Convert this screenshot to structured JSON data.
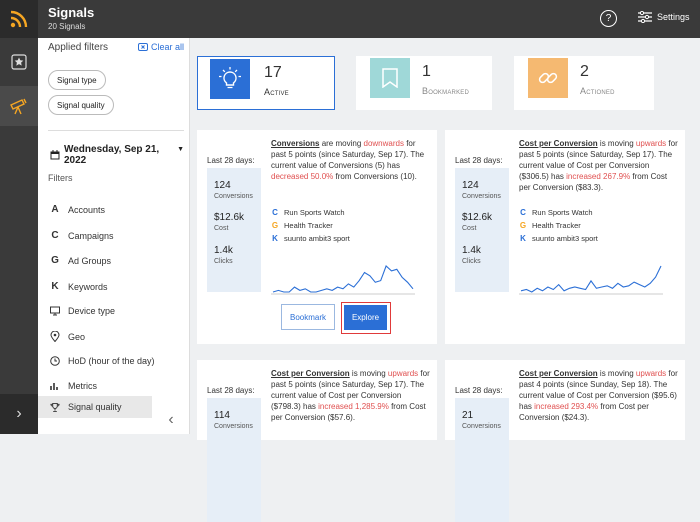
{
  "header": {
    "title": "Signals",
    "subtitle": "20 Signals",
    "settings_label": "Settings",
    "help_glyph": "?"
  },
  "sidebar": {
    "applied_label": "Applied filters",
    "clear_label": "Clear all",
    "pills": [
      "Signal type",
      "Signal quality"
    ],
    "date": "Wednesday, Sep 21, 2022",
    "filters_label": "Filters",
    "items": [
      {
        "icon": "A",
        "label": "Accounts"
      },
      {
        "icon": "C",
        "label": "Campaigns"
      },
      {
        "icon": "G",
        "label": "Ad Groups"
      },
      {
        "icon": "K",
        "label": "Keywords"
      },
      {
        "icon": "device",
        "label": "Device type"
      },
      {
        "icon": "geo",
        "label": "Geo"
      },
      {
        "icon": "clock",
        "label": "HoD (hour of the day)"
      },
      {
        "icon": "metrics",
        "label": "Metrics"
      },
      {
        "icon": "trophy",
        "label": "Signal quality"
      }
    ]
  },
  "stats": [
    {
      "value": "17",
      "label": "Active",
      "color": "#2b6fd6"
    },
    {
      "value": "1",
      "label": "Bookmarked",
      "color": "#9fd8d8"
    },
    {
      "value": "2",
      "label": "Actioned",
      "color": "#f5b971"
    }
  ],
  "cards": [
    {
      "last28": "Last 28 days:",
      "metrics": [
        {
          "value": "124",
          "label": "Conversions"
        },
        {
          "value": "$12.6k",
          "label": "Cost"
        },
        {
          "value": "1.4k",
          "label": "Clicks"
        }
      ],
      "d_metric": "Conversions",
      "d_mid": " are moving ",
      "d_dir": "downwards",
      "d_rest1": " for past 5 points (since Saturday, Sep 17). The current value of Conversions (5) has ",
      "d_change": "decreased 50.0%",
      "d_rest2": " from Conversions (10).",
      "campaigns": [
        {
          "icon": "C",
          "label": "Run Sports Watch"
        },
        {
          "icon": "G",
          "label": "Health Tracker"
        },
        {
          "icon": "K",
          "label": "suunto ambit3 sport"
        }
      ],
      "bookmark_label": "Bookmark",
      "explore_label": "Explore",
      "series": [
        6,
        7,
        6,
        6,
        9,
        7,
        8,
        6,
        6,
        7,
        8,
        7,
        9,
        8,
        11,
        9,
        13,
        18,
        16,
        12,
        13,
        22,
        19,
        20,
        15,
        12,
        8
      ]
    },
    {
      "last28": "Last 28 days:",
      "metrics": [
        {
          "value": "124",
          "label": "Conversions"
        },
        {
          "value": "$12.6k",
          "label": "Cost"
        },
        {
          "value": "1.4k",
          "label": "Clicks"
        }
      ],
      "d_metric": "Cost per Conversion",
      "d_mid": " is moving ",
      "d_dir": "upwards",
      "d_rest1": " for past 5 points (since Saturday, Sep 17). The current value of Cost per Conversion ($306.5) has ",
      "d_change": "increased 267.9%",
      "d_rest2": " from Cost per Conversion ($83.3).",
      "campaigns": [
        {
          "icon": "C",
          "label": "Run Sports Watch"
        },
        {
          "icon": "G",
          "label": "Health Tracker"
        },
        {
          "icon": "K",
          "label": "suunto ambit3 sport"
        }
      ],
      "series": [
        6,
        7,
        5,
        8,
        6,
        9,
        7,
        11,
        6,
        8,
        9,
        8,
        7,
        14,
        8,
        9,
        10,
        8,
        12,
        9,
        10,
        13,
        11,
        9,
        12,
        17,
        26
      ]
    },
    {
      "last28": "Last 28 days:",
      "metrics": [
        {
          "value": "114",
          "label": "Conversions"
        }
      ],
      "d_metric": "Cost per Conversion",
      "d_mid": " is moving ",
      "d_dir": "upwards",
      "d_rest1": " for past 5 points (since Saturday, Sep 17). The current value of Cost per Conversion ($798.3) has ",
      "d_change": "increased 1,285.9%",
      "d_rest2": " from Cost per Conversion ($57.6)."
    },
    {
      "last28": "Last 28 days:",
      "metrics": [
        {
          "value": "21",
          "label": "Conversions"
        }
      ],
      "d_metric": "Cost per Conversion",
      "d_mid": " is moving ",
      "d_dir": "upwards",
      "d_rest1": " for past 4 points (since Sunday, Sep 18). The current value of Cost per Conversion ($95.6) has ",
      "d_change": "increased 293.4%",
      "d_rest2": " from Cost per Conversion ($24.3)."
    }
  ]
}
